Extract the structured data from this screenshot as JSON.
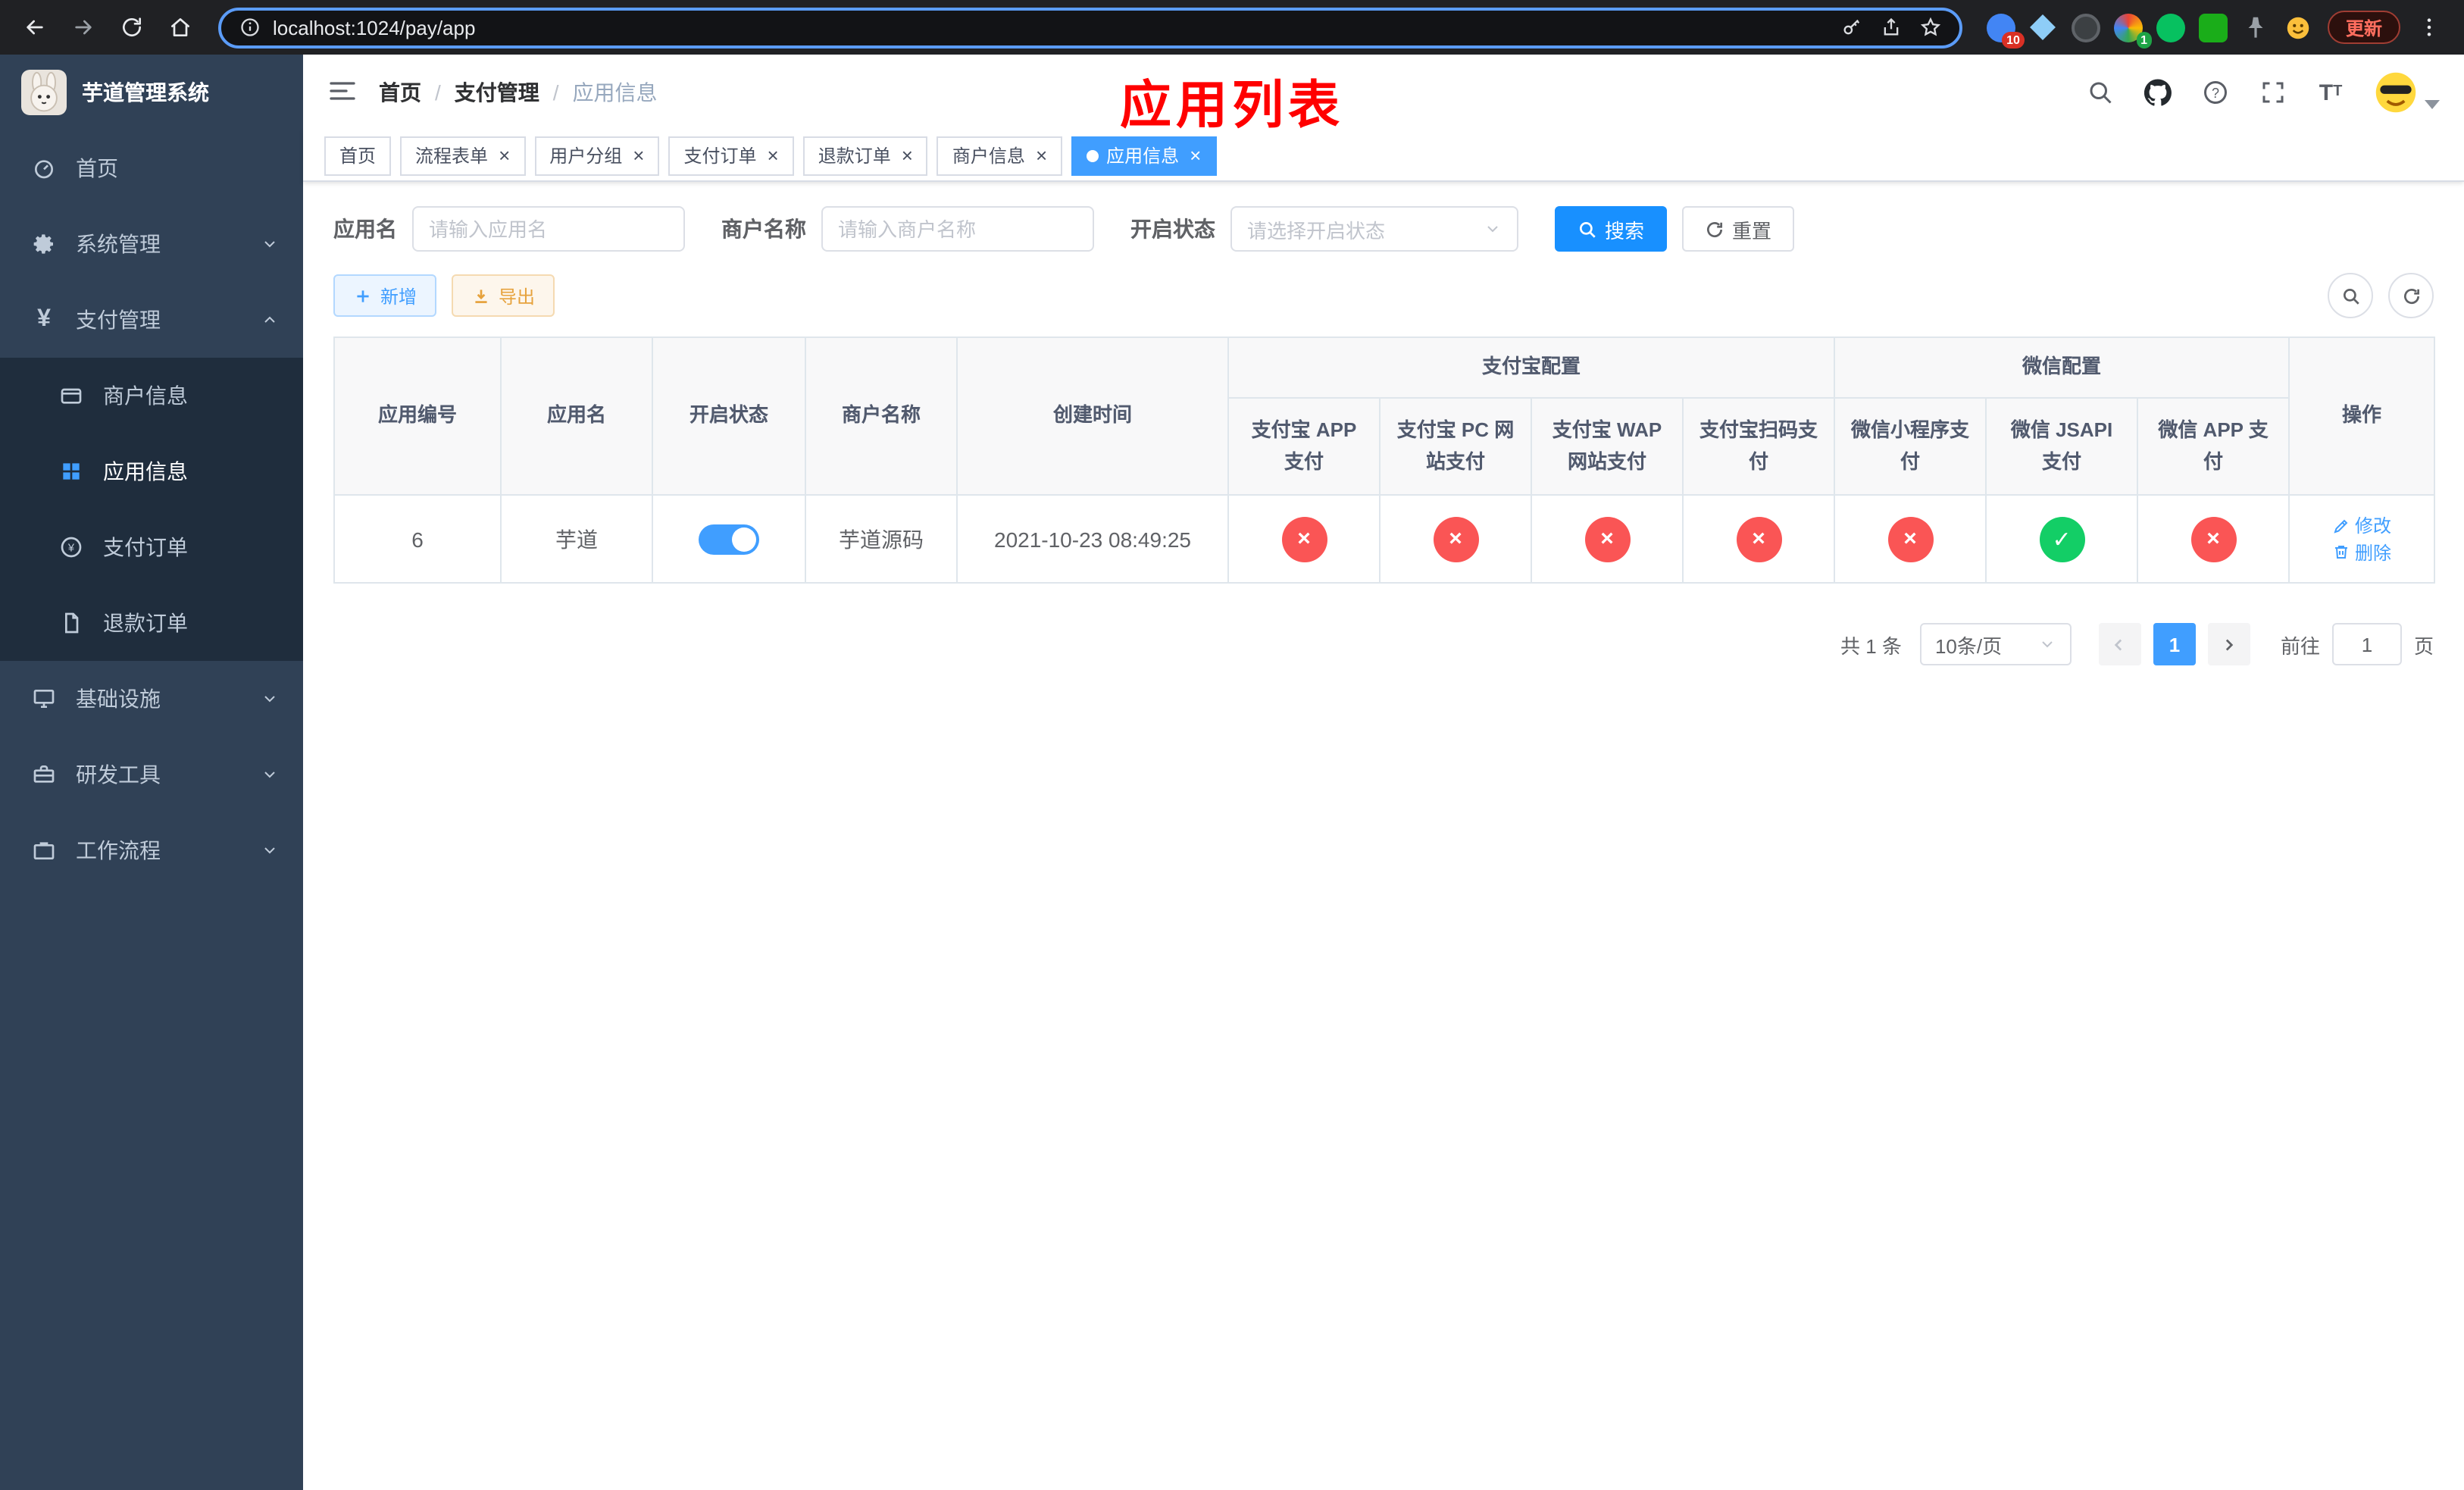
{
  "browser": {
    "url": "localhost:1024/pay/app",
    "update_label": "更新",
    "badge_ten": "10",
    "badge_one": "1"
  },
  "ui": {
    "close_glyph": "×",
    "check_glyph": "✓",
    "cross_glyph": "×",
    "breadcrumb_sep": "/",
    "yen_glyph": "¥",
    "question_glyph": "?",
    "font_glyph_large": "T",
    "font_glyph_small": "T"
  },
  "sidebar": {
    "title": "芋道管理系统",
    "home": "首页",
    "system": "系统管理",
    "payment": "支付管理",
    "merchant_info": "商户信息",
    "app_info": "应用信息",
    "pay_order": "支付订单",
    "refund_order": "退款订单",
    "infra": "基础设施",
    "dev_tools": "研发工具",
    "workflow": "工作流程"
  },
  "breadcrumb": {
    "home": "首页",
    "section": "支付管理",
    "current": "应用信息"
  },
  "annotation": "应用列表",
  "tabs": {
    "home": "首页",
    "flow_form": "流程表单",
    "user_group": "用户分组",
    "pay_order": "支付订单",
    "refund_order": "退款订单",
    "merchant_info": "商户信息",
    "app_info": "应用信息"
  },
  "filter": {
    "app_name_label": "应用名",
    "app_name_placeholder": "请输入应用名",
    "merchant_label": "商户名称",
    "merchant_placeholder": "请输入商户名称",
    "status_label": "开启状态",
    "status_placeholder": "请选择开启状态",
    "search_label": "搜索",
    "reset_label": "重置"
  },
  "toolbar": {
    "add_label": "新增",
    "export_label": "导出"
  },
  "table": {
    "headers": {
      "app_id": "应用编号",
      "app_name": "应用名",
      "status": "开启状态",
      "merchant": "商户名称",
      "created": "创建时间",
      "alipay_group": "支付宝配置",
      "wechat_group": "微信配置",
      "alipay_app": "支付宝 APP 支付",
      "alipay_pc": "支付宝 PC 网站支付",
      "alipay_wap": "支付宝 WAP 网站支付",
      "alipay_qr": "支付宝扫码支付",
      "wx_mini": "微信小程序支付",
      "wx_jsapi": "微信 JSAPI 支付",
      "wx_app": "微信 APP 支付",
      "actions": "操作"
    },
    "row": {
      "app_id": "6",
      "app_name": "芋道",
      "enabled": true,
      "merchant": "芋道源码",
      "created": "2021-10-23 08:49:25",
      "configs": [
        false,
        false,
        false,
        false,
        false,
        true,
        false
      ],
      "edit_label": "修改",
      "delete_label": "删除"
    }
  },
  "pagination": {
    "total_text": "共 1 条",
    "page_size_text": "10条/页",
    "current_page": "1",
    "goto_label": "前往",
    "goto_value": "1",
    "page_unit": "页"
  },
  "colors": {
    "primary": "#409EFF",
    "deep_blue": "#1890ff",
    "success": "#13ce66",
    "danger": "#fa5555",
    "sidebar_bg": "#304156",
    "submenu_bg": "#1f2d3d"
  }
}
